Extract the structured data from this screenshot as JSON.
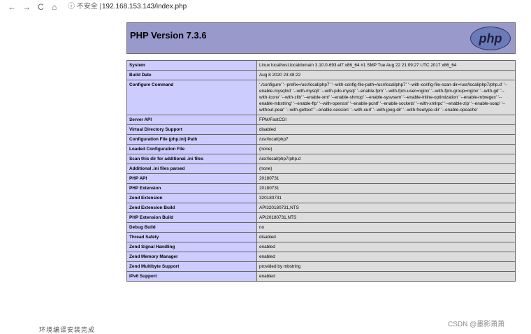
{
  "browser": {
    "back": "←",
    "forward": "→",
    "reload": "C",
    "home": "⌂",
    "security": "ⓘ 不安全 |",
    "url": "192.168.153.143/index.php"
  },
  "php": {
    "title": "PHP Version 7.3.6",
    "logo_text": "php"
  },
  "rows": [
    {
      "key": "System",
      "value": "Linux localhost.localdomain 3.10.0-693.el7.x86_64 #1 SMP Tue Aug 22 21:09:27 UTC 2017 x86_64"
    },
    {
      "key": "Build Date",
      "value": "Aug 8 2020 23:48:22"
    },
    {
      "key": "Configure Command",
      "value": "'./configure' '--prefix=/usr/local/php7' '--with-config-file-path=/usr/local/php7' '--with-config-file-scan-dir=/usr/local/php7/php.d' '--enable-mysqlnd' '--with-mysqli' '--with-pdo-mysql' '--enable-fpm' '--with-fpm-user=nginx' '--with-fpm-group=nginx' '--with-gd' '--with-iconv' '--with-zlib' '--enable-xml' '--enable-shmop' '--enable-sysvsem' '--enable-inline-optimization' '--enable-mbregex' '--enable-mbstring' '--enable-ftp' '--with-openssl' '--enable-pcntl' '--enable-sockets' '--with-xmlrpc' '--enable-zip' '--enable-soap' '--without-pear' '--with-gettext' '--enable-session' '--with-curl' '--with-jpeg-dir' '--with-freetype-dir' '--enable-opcache'"
    },
    {
      "key": "Server API",
      "value": "FPM/FastCGI"
    },
    {
      "key": "Virtual Directory Support",
      "value": "disabled"
    },
    {
      "key": "Configuration File (php.ini) Path",
      "value": "/usr/local/php7"
    },
    {
      "key": "Loaded Configuration File",
      "value": "(none)"
    },
    {
      "key": "Scan this dir for additional .ini files",
      "value": "/usr/local/php7/php.d"
    },
    {
      "key": "Additional .ini files parsed",
      "value": "(none)"
    },
    {
      "key": "PHP API",
      "value": "20180731"
    },
    {
      "key": "PHP Extension",
      "value": "20180731"
    },
    {
      "key": "Zend Extension",
      "value": "320180731"
    },
    {
      "key": "Zend Extension Build",
      "value": "API320180731,NTS"
    },
    {
      "key": "PHP Extension Build",
      "value": "API20180731,NTS"
    },
    {
      "key": "Debug Build",
      "value": "no"
    },
    {
      "key": "Thread Safety",
      "value": "disabled"
    },
    {
      "key": "Zend Signal Handling",
      "value": "enabled"
    },
    {
      "key": "Zend Memory Manager",
      "value": "enabled"
    },
    {
      "key": "Zend Multibyte Support",
      "value": "provided by mbstring"
    },
    {
      "key": "IPv6 Support",
      "value": "enabled"
    }
  ],
  "watermark": "CSDN @墨影萧萧",
  "bottom_text": "环境编译安装完成"
}
